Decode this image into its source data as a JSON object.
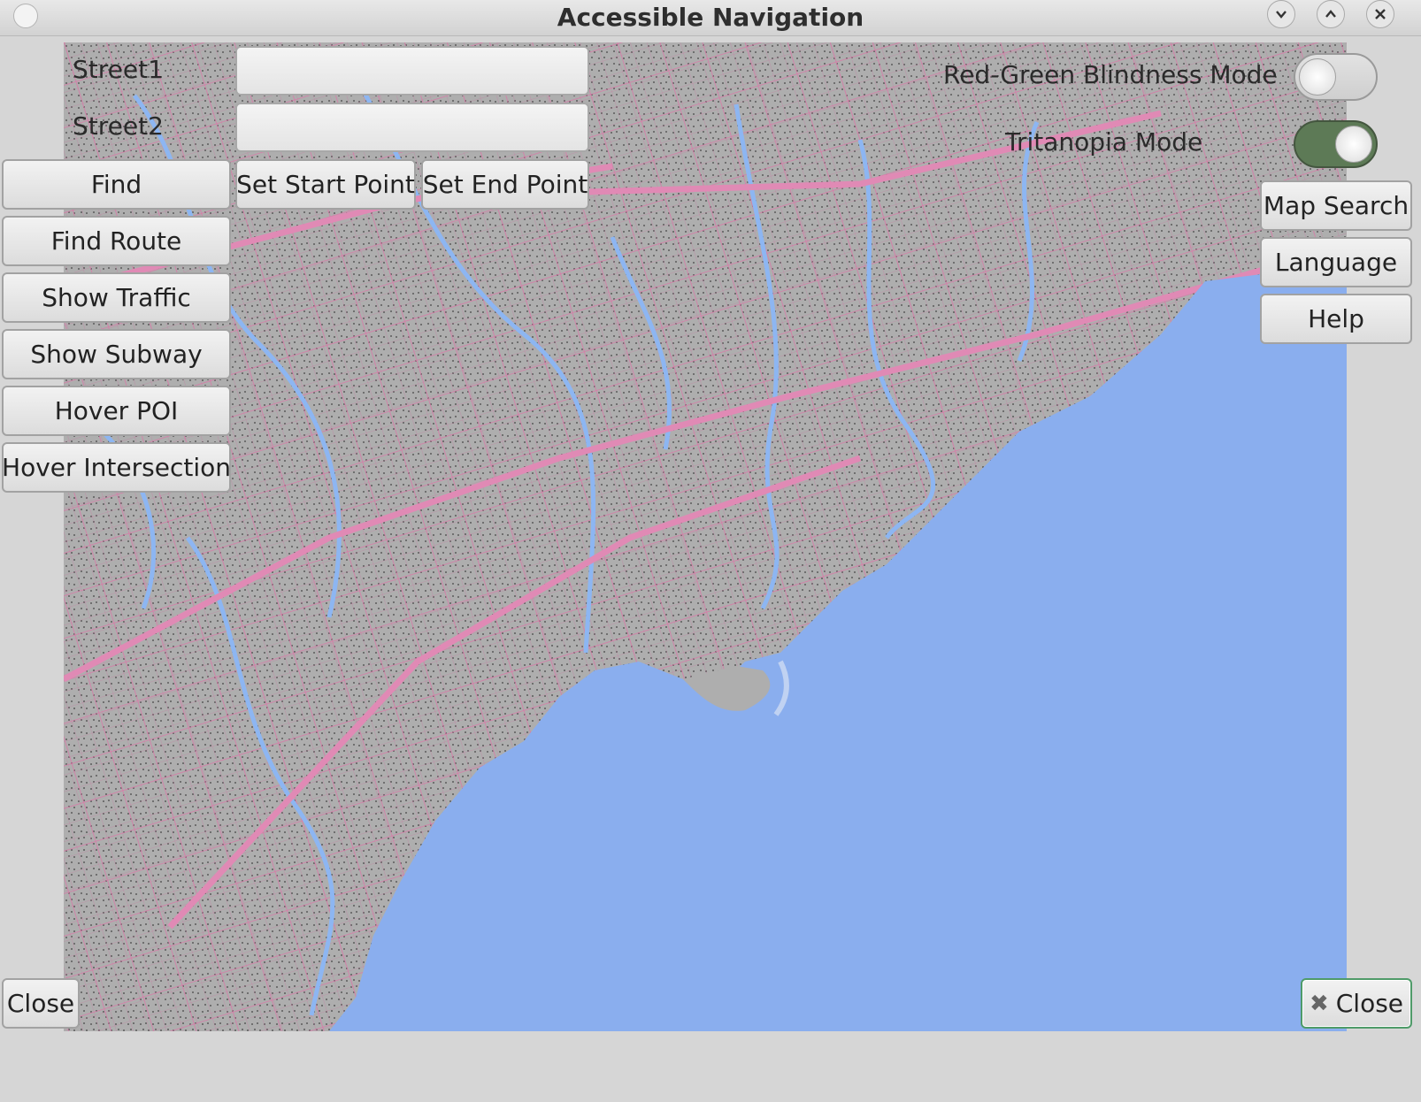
{
  "window": {
    "title": "Accessible Navigation"
  },
  "titlebar_buttons": {
    "minimize_icon": "chevron-down-icon",
    "maximize_icon": "chevron-up-icon",
    "close_icon": "close-icon"
  },
  "search": {
    "street1_label": "Street1",
    "street1_value": "",
    "street2_label": "Street2",
    "street2_value": ""
  },
  "toolbar": {
    "find": "Find",
    "set_start": "Set Start Point",
    "set_end": "Set End Point",
    "find_route": "Find Route",
    "show_traffic": "Show Traffic",
    "show_subway": "Show Subway",
    "hover_poi": "Hover POI",
    "hover_intersection": "Hover Intersection",
    "close_left": "Close"
  },
  "modes": {
    "red_green_label": "Red-Green Blindness Mode",
    "red_green_on": false,
    "tritanopia_label": "Tritanopia Mode",
    "tritanopia_on": true
  },
  "right_menu": {
    "map_search": "Map Search",
    "language": "Language",
    "help": "Help",
    "close_right": "Close"
  },
  "map_colors": {
    "land": "#aeaeae",
    "water": "#8aaeee",
    "rivers": "#8db6f2",
    "roads": "#d97aa8",
    "buildings": "#6f6f6f"
  }
}
